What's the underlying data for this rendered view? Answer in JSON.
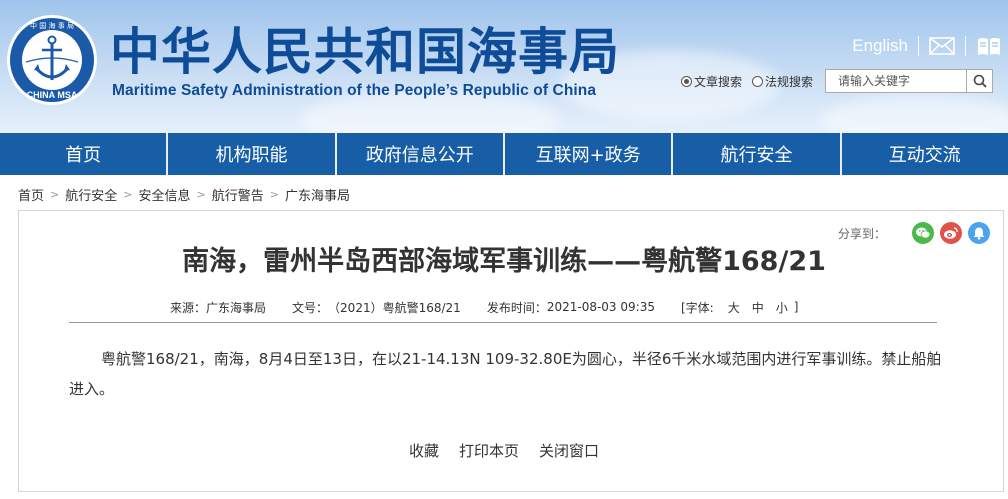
{
  "header": {
    "title_cn": "中华人民共和国海事局",
    "title_en": "Maritime Safety Administration of the People’s Republic of China",
    "logo_text_top": "中 国 海 事 局",
    "logo_text_bottom": "CHINA MSA",
    "english_link": "English",
    "search": {
      "option_article": "文章搜索",
      "option_law": "法规搜索",
      "placeholder": "请输入关键字"
    }
  },
  "nav": {
    "items": [
      "首页",
      "机构职能",
      "政府信息公开",
      "互联网+政务",
      "航行安全",
      "互动交流"
    ]
  },
  "breadcrumb": [
    "首页",
    "航行安全",
    "安全信息",
    "航行警告",
    "广东海事局"
  ],
  "share": {
    "label": "分享到："
  },
  "article": {
    "title": "南海，雷州半岛西部海域军事训练——粤航警168/21",
    "meta": {
      "source_label": "来源：",
      "source": "广东海事局",
      "doc_label": "文号：",
      "doc_no": "（2021）粤航警168/21",
      "time_label": "发布时间：",
      "time": "2021-08-03 09:35",
      "font_label": "[字体:",
      "font_large": "大",
      "font_mid": "中",
      "font_small": "小",
      "font_close": "]"
    },
    "body": "粤航警168/21，南海，8月4日至13日，在以21-14.13N 109-32.80E为圆心，半径6千米水域范围内进行军事训练。禁止船舶进入。"
  },
  "actions": {
    "favorite": "收藏",
    "print": "打印本页",
    "close": "关闭窗口"
  },
  "colors": {
    "brand": "#0f4c98",
    "nav": "#175ea6",
    "wechat": "#4ab84a",
    "weibo": "#e0534b",
    "qq": "#4aa3ee"
  }
}
